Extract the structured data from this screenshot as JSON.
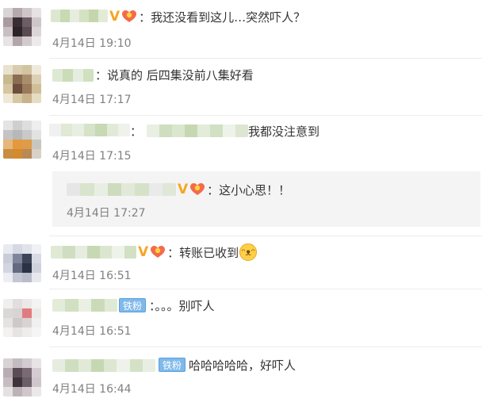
{
  "comments": [
    {
      "text": "：我还没看到这儿…突然吓人？",
      "time": "4月14日 19:10",
      "vip": "V"
    },
    {
      "text": "：说真的 后四集没前八集好看",
      "time": "4月14日 17:17"
    },
    {
      "text": "我都没注意到",
      "time": "4月14日 17:15",
      "colon": "："
    },
    {
      "text": "：这小心思！！",
      "time": "4月14日 17:27",
      "vip": "V"
    },
    {
      "text": "：转账已收到",
      "time": "4月14日 16:51",
      "vip": "V",
      "emoji": "cat-face-emoji"
    },
    {
      "text": "：。。。别吓人",
      "time": "4月14日 16:51",
      "badge": "铁粉"
    },
    {
      "text": "哈哈哈哈哈，好吓人",
      "time": "4月14日 16:44",
      "badge": "铁粉"
    }
  ],
  "icons": {
    "vip": "vip-v-icon",
    "heart": "fan-heart-icon",
    "emoji": "cat-face-emoji"
  },
  "colors": {
    "vip": "#f5a623",
    "badge": "#7fb9ea",
    "time": "#808080",
    "text": "#333333",
    "reply_bg": "#f4f4f4"
  }
}
